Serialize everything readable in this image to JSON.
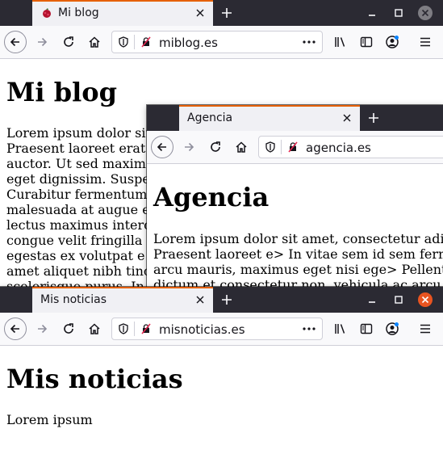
{
  "windows": {
    "blog": {
      "tab_title": "Mi blog",
      "url": "miblog.es",
      "heading": "Mi blog",
      "body_lines": [
        "Lorem ipsum dolor sit",
        "Praesent laoreet erat",
        "auctor. Ut sed maxim",
        "eget dignissim. Suspe",
        "Curabitur fermentum",
        "malesuada at augue e",
        "lectus maximus interc",
        "congue velit fringilla",
        "egestas ex volutpat e",
        "amet aliquet nibh tinc",
        "scelerisque purus. In"
      ]
    },
    "agencia": {
      "tab_title": "Agencia",
      "url": "agencia.es",
      "heading": "Agencia",
      "body_lines": [
        "Lorem ipsum dolor sit amet, consectetur adi",
        "Praesent laoreet e> In vitae sem id sem ferm",
        "arcu mauris, maximus eget nisi ege> Pellent",
        "dictum et consectetur non, vehicula ac arcu."
      ]
    },
    "noticias": {
      "tab_title": "Mis noticias",
      "url": "misnoticias.es",
      "heading": "Mis noticias",
      "body_lines": [
        "Lorem ipsum"
      ]
    }
  },
  "colors": {
    "titlebar": "#2b2a33",
    "tab_active": "#f0f0f4",
    "tab_accent": "#e66000",
    "toolbar": "#f9f9fb",
    "close_button_active": "#e95420",
    "close_button_inactive": "#7e7d83"
  },
  "icons": {
    "favicon": "raspberry-favicon-icon",
    "tab_close": "close-icon",
    "new_tab": "plus-icon",
    "minimize": "minimize-icon",
    "maximize": "maximize-icon",
    "window_close": "window-close-icon",
    "back": "back-arrow-icon",
    "forward": "forward-arrow-icon",
    "reload": "reload-icon",
    "home": "home-icon",
    "tracking": "shield-icon",
    "insecure": "insecure-lock-icon",
    "page_actions": "more-dots-icon",
    "library": "library-icon",
    "sidebar": "sidebar-icon",
    "account": "account-icon",
    "menu": "hamburger-menu-icon"
  }
}
